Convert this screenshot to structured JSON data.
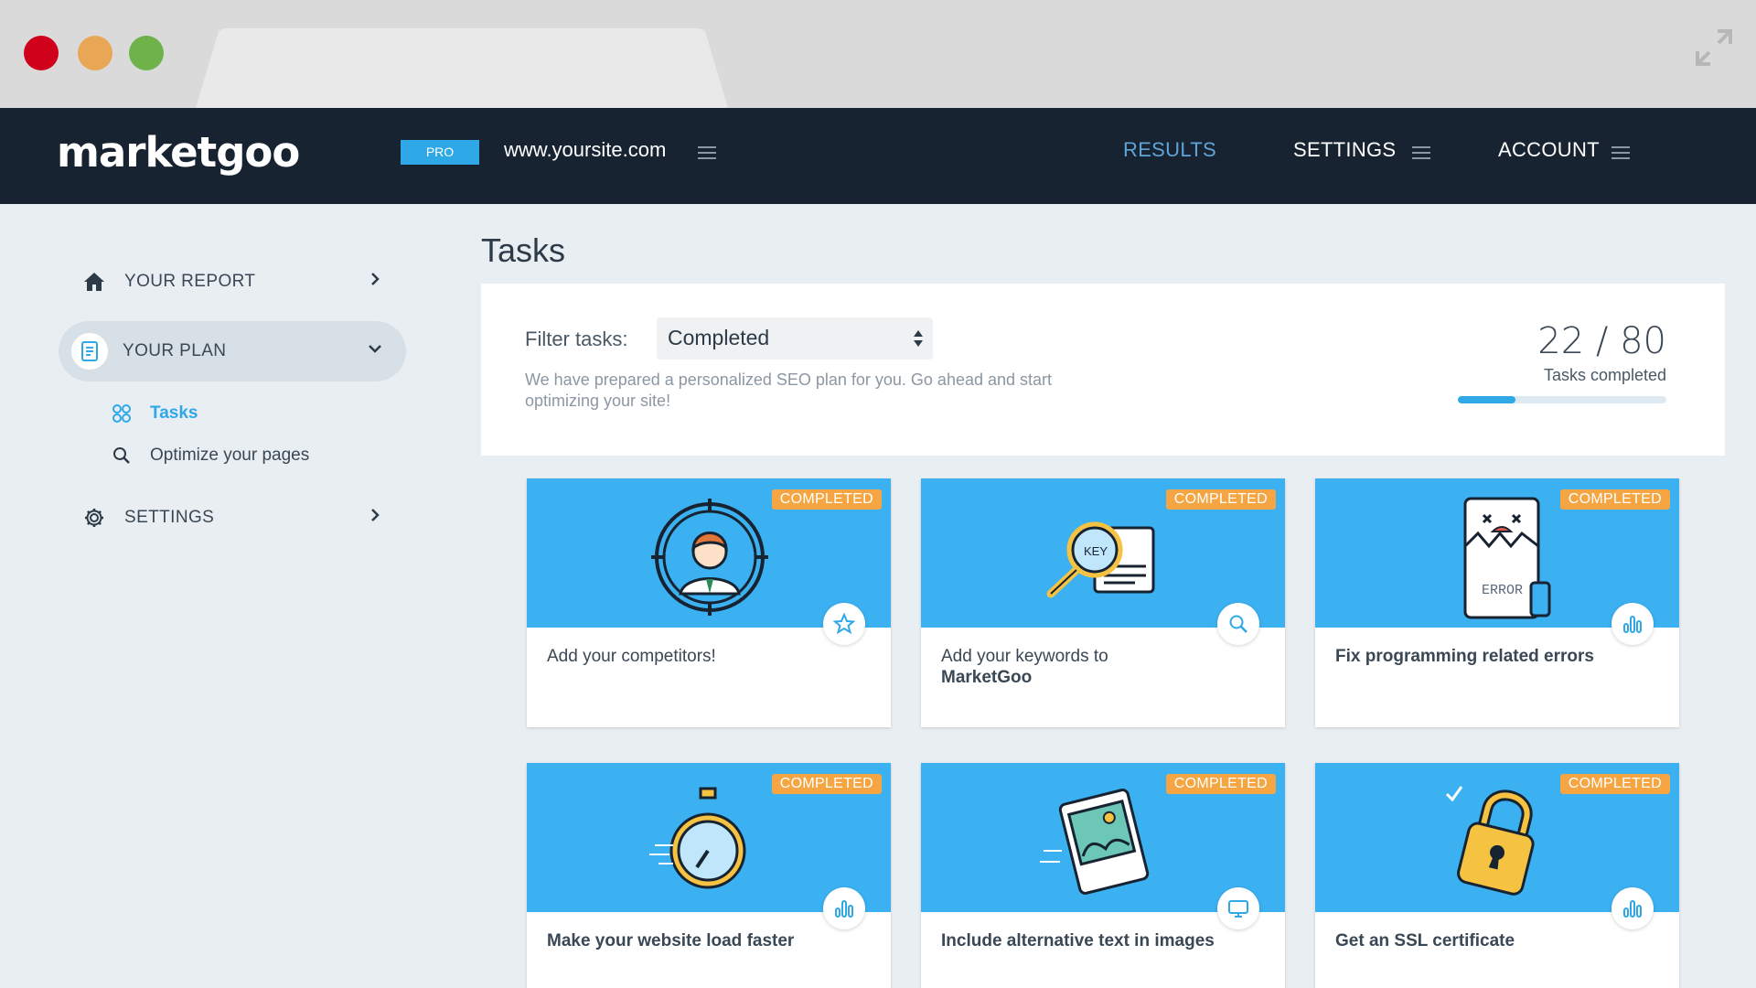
{
  "app": {
    "logo": "marketgoo",
    "plan_badge": "PRO",
    "site_url": "www.yoursite.com"
  },
  "nav": {
    "results": "RESULTS",
    "settings": "SETTINGS",
    "account": "ACCOUNT"
  },
  "sidebar": {
    "your_report": "YOUR REPORT",
    "your_plan": "YOUR PLAN",
    "sub_items": {
      "tasks": "Tasks",
      "optimize": "Optimize your pages"
    },
    "settings": "SETTINGS"
  },
  "page": {
    "title": "Tasks"
  },
  "filter": {
    "label": "Filter tasks:",
    "selected": "Completed",
    "description": "We have prepared a personalized SEO plan for you. Go ahead and start optimizing your site!"
  },
  "progress": {
    "count": "22 / 80",
    "label": "Tasks completed",
    "fraction": 0.275
  },
  "colors": {
    "accent": "#2fa8e8",
    "nav_bg": "#172331",
    "badge": "#f5a542",
    "hero": "#3cb1f2"
  },
  "cards": [
    {
      "badge": "COMPLETED",
      "title": "Add your competitors!",
      "bold": "",
      "icon": "star-icon"
    },
    {
      "badge": "COMPLETED",
      "title": "Add your keywords to",
      "bold": "MarketGoo",
      "icon": "search-icon"
    },
    {
      "badge": "COMPLETED",
      "title": "Fix programming related errors",
      "bold": "",
      "icon": "bar-chart-icon"
    },
    {
      "badge": "COMPLETED",
      "title": "Make your website load faster",
      "bold": "",
      "icon": "bar-chart-icon"
    },
    {
      "badge": "COMPLETED",
      "title": "Include alternative text in images",
      "bold": "",
      "icon": "monitor-icon"
    },
    {
      "badge": "COMPLETED",
      "title": "Get an SSL certificate",
      "bold": "",
      "icon": "bar-chart-icon"
    }
  ],
  "illustrations": {
    "key_label": "KEY",
    "error_label": "ERROR"
  }
}
